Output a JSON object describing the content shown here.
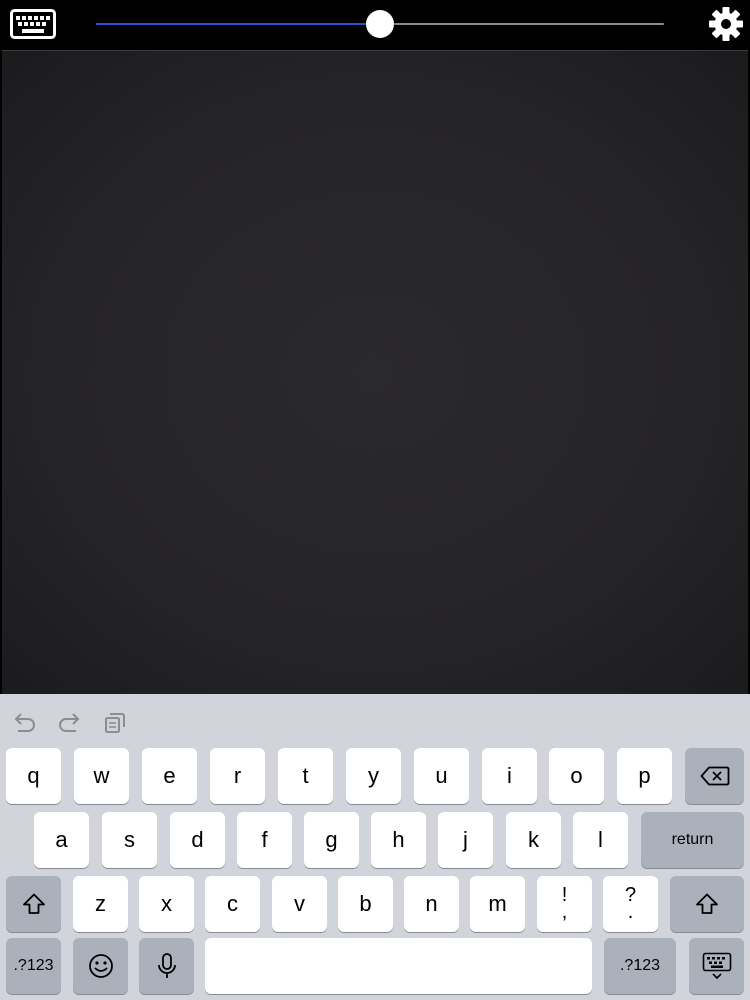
{
  "toolbar": {
    "keyboard_icon": "keyboard-icon",
    "settings_icon": "gear-icon",
    "slider": {
      "value": 0.5,
      "fill_color": "#2b52d8",
      "track_color": "#8a8a8e"
    }
  },
  "colors": {
    "canvas": "#252426",
    "keyboard_bg": "#d1d4da",
    "key": "#ffffff",
    "key_dark": "#abb1ba"
  },
  "assistant_bar": {
    "icons": [
      "undo-icon",
      "redo-icon",
      "paste-icon"
    ]
  },
  "keyboard": {
    "row1": [
      "q",
      "w",
      "e",
      "r",
      "t",
      "y",
      "u",
      "i",
      "o",
      "p"
    ],
    "row2": [
      "a",
      "s",
      "d",
      "f",
      "g",
      "h",
      "j",
      "k",
      "l"
    ],
    "row3": [
      "z",
      "x",
      "c",
      "v",
      "b",
      "n",
      "m"
    ],
    "punct": [
      {
        "top": "!",
        "bottom": ","
      },
      {
        "top": "?",
        "bottom": "."
      }
    ],
    "return_label": "return",
    "numbers_label": ".?123",
    "icons": {
      "backspace": "backspace-icon",
      "shift": "shift-icon",
      "emoji": "emoji-icon",
      "mic": "microphone-icon",
      "dismiss": "keyboard-dismiss-icon"
    }
  }
}
